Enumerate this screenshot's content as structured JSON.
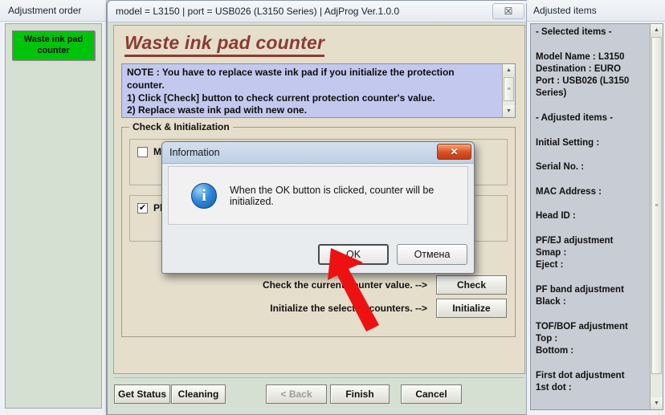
{
  "left_panel": {
    "header": "Adjustment order",
    "items": [
      {
        "label": "Waste ink pad counter",
        "color": "#00c40b"
      }
    ]
  },
  "center_window": {
    "title": "model = L3150 | port = USB026 (L3150 Series) | AdjProg Ver.1.0.0",
    "close_glyph": "☒",
    "heading": "Waste ink pad counter",
    "note": "NOTE : You have to replace waste ink pad if you initialize the protection counter.\n1) Click [Check] button to check current protection counter's value.\n2) Replace waste ink pad with new one.",
    "group": {
      "label": "Check & Initialization",
      "checkboxes": [
        {
          "label": "Main pad counter",
          "checked": false,
          "mark": ""
        },
        {
          "label": "Platen pad counter",
          "checked": true,
          "mark": "✔"
        }
      ],
      "actions": [
        {
          "label": "Check the current counter value. -->",
          "button": "Check"
        },
        {
          "label": "Initialize the selected counters. -->",
          "button": "Initialize"
        }
      ]
    },
    "footer_buttons": [
      {
        "label": "Get Status",
        "disabled": false
      },
      {
        "label": "Cleaning",
        "disabled": false
      },
      {
        "label": "< Back",
        "disabled": true
      },
      {
        "label": "Finish",
        "disabled": false
      },
      {
        "label": "Cancel",
        "disabled": false
      }
    ]
  },
  "right_panel": {
    "header": "Adjusted items",
    "content": "- Selected items -\n\nModel Name : L3150\nDestination : EURO\nPort : USB026 (L3150 Series)\n\n- Adjusted items -\n\nInitial Setting :\n\nSerial No. :\n\nMAC Address :\n\nHead ID :\n\nPF/EJ adjustment\n Smap :\n Eject :\n\nPF band adjustment\n Black :\n\nTOF/BOF adjustment\n Top :\n Bottom :\n\nFirst dot adjustment\n 1st dot :"
  },
  "dialog": {
    "title": "Information",
    "close_glyph": "✕",
    "icon_glyph": "i",
    "message": "When the OK button is clicked, counter will be initialized.",
    "ok_label": "OK",
    "cancel_label": "Отмена"
  },
  "annotation": {
    "arrow_color": "#ee1111",
    "points_at": "OK"
  },
  "scrollbars": {
    "up_glyph": "▲",
    "down_glyph": "▼",
    "grip_glyph": "≡"
  }
}
